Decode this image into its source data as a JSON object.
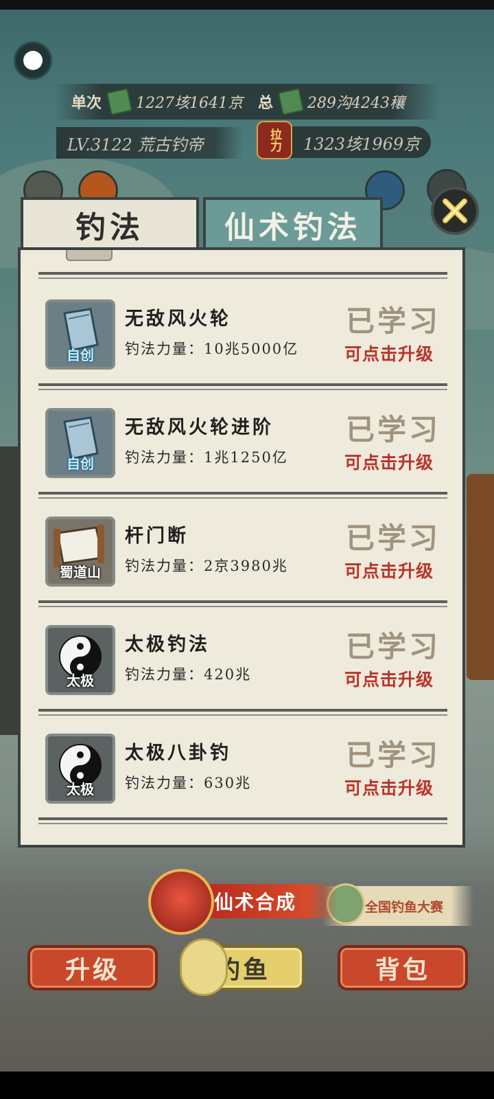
{
  "header": {
    "single_label": "单次",
    "single_value": "1227垓1641京",
    "total_label": "总",
    "total_value": "289沟4243穰",
    "level_text": "LV.3122 荒古钓帝",
    "power_icon_text": "拉力",
    "power_value": "1323垓1969京"
  },
  "tabs": [
    {
      "label": "钓法",
      "active": true
    },
    {
      "label": "仙术钓法",
      "active": false
    }
  ],
  "skills": [
    {
      "name": "无敌风火轮",
      "power": "钓法力量：10兆5000亿",
      "tag": "自创",
      "icon": "blue-scroll-icon",
      "status": "已学习",
      "action": "可点击升级"
    },
    {
      "name": "无敌风火轮进阶",
      "power": "钓法力量：1兆1250亿",
      "tag": "自创",
      "icon": "blue-scroll-icon",
      "status": "已学习",
      "action": "可点击升级"
    },
    {
      "name": "杆门断",
      "power": "钓法力量：2京3980兆",
      "tag": "蜀道山",
      "icon": "paper-scroll-icon",
      "status": "已学习",
      "action": "可点击升级"
    },
    {
      "name": "太极钓法",
      "power": "钓法力量：420兆",
      "tag": "太极",
      "icon": "taiji-icon",
      "status": "已学习",
      "action": "可点击升级"
    },
    {
      "name": "太极八卦钓",
      "power": "钓法力量：630兆",
      "tag": "太极",
      "icon": "taiji-icon",
      "status": "已学习",
      "action": "可点击升级"
    }
  ],
  "bottom": {
    "synthesis_label": "仙术合成",
    "contest_label": "全国钓鱼大赛",
    "upgrade_label": "升级",
    "fishing_label": "钓鱼",
    "bag_label": "背包"
  },
  "colors": {
    "learned": "#a0947e",
    "upgrade_hint": "#b8342a",
    "panel_bg": "#eeeadc",
    "tab_inactive": "#6a9b96"
  }
}
